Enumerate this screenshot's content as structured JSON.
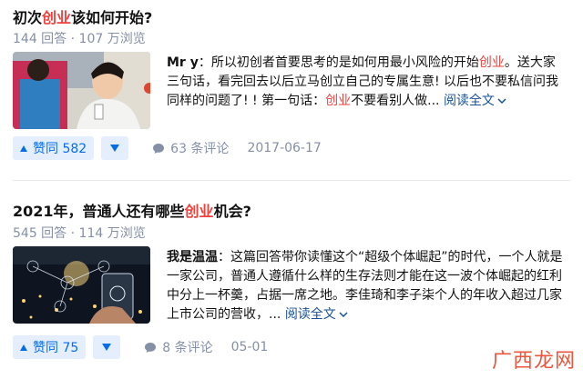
{
  "q1": {
    "title_pre": "初次",
    "title_hl": "创业",
    "title_post": "该如何开始?",
    "answers": "144 回答",
    "dot": "·",
    "views": "107 万浏览",
    "author": "Mr y",
    "colon": "：",
    "ex_1": "所以初创者首要思考的是如何用最小风险的开始",
    "ex_hl1": "创业",
    "ex_2": "。送大家三句话，看完回去以后立马创立自己的专属生意! 以后也不要私信问我同样的问题了! ! 第一句话：",
    "ex_hl2": "创业",
    "ex_3": "不要看别人做...",
    "read_more": "阅读全文",
    "vote_label": "赞同 582",
    "comments": "63 条评论",
    "date": "2017-06-17"
  },
  "q2": {
    "title_pre": "2021年，普通人还有哪些",
    "title_hl": "创业",
    "title_post": "机会?",
    "answers": "545 回答",
    "dot": "·",
    "views": "114 万浏览",
    "author": "我是温温",
    "colon": "：",
    "ex_1": "这篇回答带你读懂这个“超级个体崛起”的时代，一个人就是一家公司，普通人遵循什么样的生存法则才能在这一波个体崛起的红利中分上一杯羹，占据一席之地。李佳琦和李子柒个人的年收入超过几家上市公司的营收，...",
    "read_more": "阅读全文",
    "vote_label": "赞同 75",
    "comments": "8 条评论",
    "date": "05-01"
  },
  "watermark": "广西龙网",
  "colors": {
    "accent": "#056de8",
    "highlight": "#f1403c",
    "link": "#175199",
    "meta": "#8590a6"
  }
}
